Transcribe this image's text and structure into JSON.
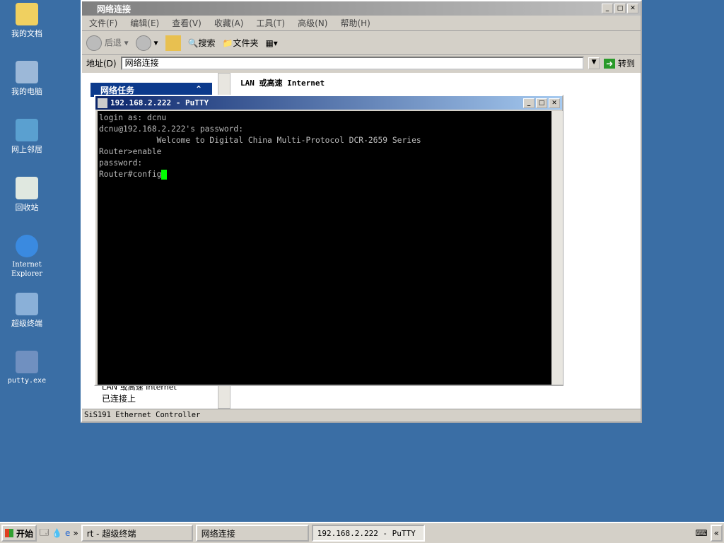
{
  "desktop": [
    "我的文档",
    "我的电脑",
    "网上邻居",
    "回收站",
    "Internet Explorer",
    "超级终端",
    "putty.exe"
  ],
  "explorer": {
    "title": "网络连接",
    "menu": [
      "文件(F)",
      "编辑(E)",
      "查看(V)",
      "收藏(A)",
      "工具(T)",
      "高级(N)",
      "帮助(H)"
    ],
    "toolbar": {
      "back": "后退",
      "search": "搜索",
      "folders": "文件夹"
    },
    "address_label": "地址(D)",
    "address": "网络连接",
    "go": "转到",
    "task_header": "网络任务",
    "content_header": "LAN 或高速 Internet",
    "left_item": "LAN 或高速 Internet",
    "left_status": "已连接上",
    "status": "SiS191 Ethernet Controller"
  },
  "putty": {
    "title": "192.168.2.222 - PuTTY",
    "lines": [
      "login as: dcnu",
      "dcnu@192.168.2.222's password:",
      "",
      "            Welcome to Digital China Multi-Protocol DCR-2659 Series",
      "",
      "Router>enable",
      "password:"
    ],
    "prompt": "Router#config"
  },
  "taskbar": {
    "start": "开始",
    "items": [
      "rt - 超级终端",
      "网络连接",
      "192.168.2.222 - PuTTY"
    ],
    "chevron": "»",
    "tray_chevron": "«"
  }
}
